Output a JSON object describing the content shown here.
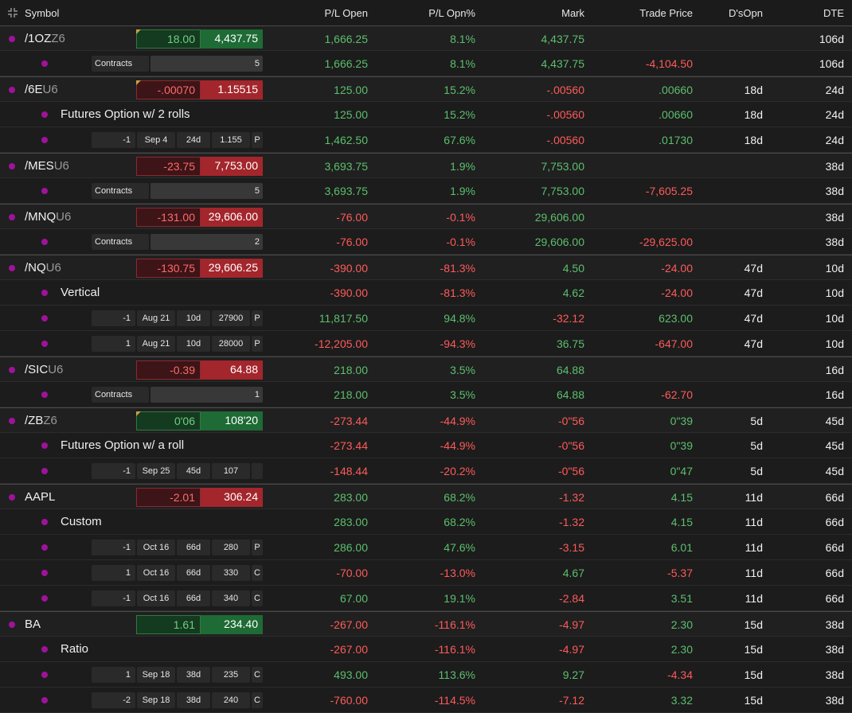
{
  "header": {
    "symbol": "Symbol",
    "pl_open": "P/L Open",
    "pl_opn_pct": "P/L Opn%",
    "mark": "Mark",
    "trade_price": "Trade Price",
    "ds_opn": "D'sOpn",
    "dte": "DTE"
  },
  "colors": {
    "dot": "#a0129a",
    "positive": "#5cbf6d",
    "negative": "#ff5a5a"
  },
  "rows": [
    {
      "kind": "parent",
      "root": "/1OZ",
      "exp": "Z6",
      "chg": "18.00",
      "chg_dir": "up",
      "flag": true,
      "price": "4,437.75",
      "pl": "1,666.25",
      "plc": "pos",
      "pct": "8.1%",
      "pctc": "pos",
      "mark": "4,437.75",
      "markc": "pos",
      "trade": "",
      "tradec": "",
      "ds": "",
      "dte": "106d"
    },
    {
      "kind": "contracts",
      "label": "Contracts",
      "qty": "5",
      "pl": "1,666.25",
      "plc": "pos",
      "pct": "8.1%",
      "pctc": "pos",
      "mark": "4,437.75",
      "markc": "pos",
      "trade": "-4,104.50",
      "tradec": "neg",
      "ds": "",
      "dte": "106d"
    },
    {
      "kind": "parent",
      "root": "/6E",
      "exp": "U6",
      "chg": "-.00070",
      "chg_dir": "down",
      "flag": true,
      "price": "1.15515",
      "pl": "125.00",
      "plc": "pos",
      "pct": "15.2%",
      "pctc": "pos",
      "mark": "-.00560",
      "markc": "neg",
      "trade": ".00660",
      "tradec": "pos",
      "ds": "18d",
      "dte": "24d"
    },
    {
      "kind": "strategy",
      "label": "Futures Option w/ 2 rolls",
      "pl": "125.00",
      "plc": "pos",
      "pct": "15.2%",
      "pctc": "pos",
      "mark": "-.00560",
      "markc": "neg",
      "trade": ".00660",
      "tradec": "pos",
      "ds": "18d",
      "dte": "24d"
    },
    {
      "kind": "leg",
      "qty": "-1",
      "date": "Sep 4",
      "days": "24d",
      "strike": "1.155",
      "type": "P",
      "pl": "1,462.50",
      "plc": "pos",
      "pct": "67.6%",
      "pctc": "pos",
      "mark": "-.00560",
      "markc": "neg",
      "trade": ".01730",
      "tradec": "pos",
      "ds": "18d",
      "dte": "24d"
    },
    {
      "kind": "parent",
      "root": "/MES",
      "exp": "U6",
      "chg": "-23.75",
      "chg_dir": "down",
      "flag": false,
      "price": "7,753.00",
      "pl": "3,693.75",
      "plc": "pos",
      "pct": "1.9%",
      "pctc": "pos",
      "mark": "7,753.00",
      "markc": "pos",
      "trade": "",
      "tradec": "",
      "ds": "",
      "dte": "38d"
    },
    {
      "kind": "contracts",
      "label": "Contracts",
      "qty": "5",
      "pl": "3,693.75",
      "plc": "pos",
      "pct": "1.9%",
      "pctc": "pos",
      "mark": "7,753.00",
      "markc": "pos",
      "trade": "-7,605.25",
      "tradec": "neg",
      "ds": "",
      "dte": "38d"
    },
    {
      "kind": "parent",
      "root": "/MNQ",
      "exp": "U6",
      "chg": "-131.00",
      "chg_dir": "down",
      "flag": false,
      "price": "29,606.00",
      "pl": "-76.00",
      "plc": "neg",
      "pct": "-0.1%",
      "pctc": "neg",
      "mark": "29,606.00",
      "markc": "pos",
      "trade": "",
      "tradec": "",
      "ds": "",
      "dte": "38d"
    },
    {
      "kind": "contracts",
      "label": "Contracts",
      "qty": "2",
      "pl": "-76.00",
      "plc": "neg",
      "pct": "-0.1%",
      "pctc": "neg",
      "mark": "29,606.00",
      "markc": "pos",
      "trade": "-29,625.00",
      "tradec": "neg",
      "ds": "",
      "dte": "38d"
    },
    {
      "kind": "parent",
      "root": "/NQ",
      "exp": "U6",
      "chg": "-130.75",
      "chg_dir": "down",
      "flag": false,
      "price": "29,606.25",
      "pl": "-390.00",
      "plc": "neg",
      "pct": "-81.3%",
      "pctc": "neg",
      "mark": "4.50",
      "markc": "pos",
      "trade": "-24.00",
      "tradec": "neg",
      "ds": "47d",
      "dte": "10d"
    },
    {
      "kind": "strategy",
      "label": "Vertical",
      "pl": "-390.00",
      "plc": "neg",
      "pct": "-81.3%",
      "pctc": "neg",
      "mark": "4.62",
      "markc": "pos",
      "trade": "-24.00",
      "tradec": "neg",
      "ds": "47d",
      "dte": "10d"
    },
    {
      "kind": "leg",
      "qty": "-1",
      "date": "Aug 21",
      "days": "10d",
      "strike": "27900",
      "type": "P",
      "pl": "11,817.50",
      "plc": "pos",
      "pct": "94.8%",
      "pctc": "pos",
      "mark": "-32.12",
      "markc": "neg",
      "trade": "623.00",
      "tradec": "pos",
      "ds": "47d",
      "dte": "10d"
    },
    {
      "kind": "leg",
      "qty": "1",
      "date": "Aug 21",
      "days": "10d",
      "strike": "28000",
      "type": "P",
      "pl": "-12,205.00",
      "plc": "neg",
      "pct": "-94.3%",
      "pctc": "neg",
      "mark": "36.75",
      "markc": "pos",
      "trade": "-647.00",
      "tradec": "neg",
      "ds": "47d",
      "dte": "10d"
    },
    {
      "kind": "parent",
      "root": "/SIC",
      "exp": "U6",
      "chg": "-0.39",
      "chg_dir": "down",
      "flag": false,
      "price": "64.88",
      "pl": "218.00",
      "plc": "pos",
      "pct": "3.5%",
      "pctc": "pos",
      "mark": "64.88",
      "markc": "pos",
      "trade": "",
      "tradec": "",
      "ds": "",
      "dte": "16d"
    },
    {
      "kind": "contracts",
      "label": "Contracts",
      "qty": "1",
      "pl": "218.00",
      "plc": "pos",
      "pct": "3.5%",
      "pctc": "pos",
      "mark": "64.88",
      "markc": "pos",
      "trade": "-62.70",
      "tradec": "neg",
      "ds": "",
      "dte": "16d"
    },
    {
      "kind": "parent",
      "root": "/ZB",
      "exp": "Z6",
      "chg": "0'06",
      "chg_dir": "up",
      "flag": true,
      "price": "108'20",
      "pl": "-273.44",
      "plc": "neg",
      "pct": "-44.9%",
      "pctc": "neg",
      "mark": "-0\"56",
      "markc": "neg",
      "trade": "0\"39",
      "tradec": "pos",
      "ds": "5d",
      "dte": "45d"
    },
    {
      "kind": "strategy",
      "label": "Futures Option w/ a roll",
      "pl": "-273.44",
      "plc": "neg",
      "pct": "-44.9%",
      "pctc": "neg",
      "mark": "-0\"56",
      "markc": "neg",
      "trade": "0\"39",
      "tradec": "pos",
      "ds": "5d",
      "dte": "45d"
    },
    {
      "kind": "leg",
      "qty": "-1",
      "date": "Sep 25",
      "days": "45d",
      "strike": "107",
      "type": "",
      "pl": "-148.44",
      "plc": "neg",
      "pct": "-20.2%",
      "pctc": "neg",
      "mark": "-0\"56",
      "markc": "neg",
      "trade": "0\"47",
      "tradec": "pos",
      "ds": "5d",
      "dte": "45d"
    },
    {
      "kind": "parent",
      "root": "AAPL",
      "exp": "",
      "chg": "-2.01",
      "chg_dir": "down",
      "flag": false,
      "price": "306.24",
      "pl": "283.00",
      "plc": "pos",
      "pct": "68.2%",
      "pctc": "pos",
      "mark": "-1.32",
      "markc": "neg",
      "trade": "4.15",
      "tradec": "pos",
      "ds": "11d",
      "dte": "66d"
    },
    {
      "kind": "strategy",
      "label": "Custom",
      "pl": "283.00",
      "plc": "pos",
      "pct": "68.2%",
      "pctc": "pos",
      "mark": "-1.32",
      "markc": "neg",
      "trade": "4.15",
      "tradec": "pos",
      "ds": "11d",
      "dte": "66d"
    },
    {
      "kind": "leg",
      "qty": "-1",
      "date": "Oct 16",
      "days": "66d",
      "strike": "280",
      "type": "P",
      "pl": "286.00",
      "plc": "pos",
      "pct": "47.6%",
      "pctc": "pos",
      "mark": "-3.15",
      "markc": "neg",
      "trade": "6.01",
      "tradec": "pos",
      "ds": "11d",
      "dte": "66d"
    },
    {
      "kind": "leg",
      "qty": "1",
      "date": "Oct 16",
      "days": "66d",
      "strike": "330",
      "type": "C",
      "pl": "-70.00",
      "plc": "neg",
      "pct": "-13.0%",
      "pctc": "neg",
      "mark": "4.67",
      "markc": "pos",
      "trade": "-5.37",
      "tradec": "neg",
      "ds": "11d",
      "dte": "66d"
    },
    {
      "kind": "leg",
      "qty": "-1",
      "date": "Oct 16",
      "days": "66d",
      "strike": "340",
      "type": "C",
      "pl": "67.00",
      "plc": "pos",
      "pct": "19.1%",
      "pctc": "pos",
      "mark": "-2.84",
      "markc": "neg",
      "trade": "3.51",
      "tradec": "pos",
      "ds": "11d",
      "dte": "66d"
    },
    {
      "kind": "parent",
      "root": "BA",
      "exp": "",
      "chg": "1.61",
      "chg_dir": "up",
      "flag": false,
      "price": "234.40",
      "pl": "-267.00",
      "plc": "neg",
      "pct": "-116.1%",
      "pctc": "neg",
      "mark": "-4.97",
      "markc": "neg",
      "trade": "2.30",
      "tradec": "pos",
      "ds": "15d",
      "dte": "38d"
    },
    {
      "kind": "strategy",
      "label": "Ratio",
      "pl": "-267.00",
      "plc": "neg",
      "pct": "-116.1%",
      "pctc": "neg",
      "mark": "-4.97",
      "markc": "neg",
      "trade": "2.30",
      "tradec": "pos",
      "ds": "15d",
      "dte": "38d"
    },
    {
      "kind": "leg",
      "qty": "1",
      "date": "Sep 18",
      "days": "38d",
      "strike": "235",
      "type": "C",
      "pl": "493.00",
      "plc": "pos",
      "pct": "113.6%",
      "pctc": "pos",
      "mark": "9.27",
      "markc": "pos",
      "trade": "-4.34",
      "tradec": "neg",
      "ds": "15d",
      "dte": "38d"
    },
    {
      "kind": "leg",
      "qty": "-2",
      "date": "Sep 18",
      "days": "38d",
      "strike": "240",
      "type": "C",
      "pl": "-760.00",
      "plc": "neg",
      "pct": "-114.5%",
      "pctc": "neg",
      "mark": "-7.12",
      "markc": "neg",
      "trade": "3.32",
      "tradec": "pos",
      "ds": "15d",
      "dte": "38d"
    }
  ]
}
